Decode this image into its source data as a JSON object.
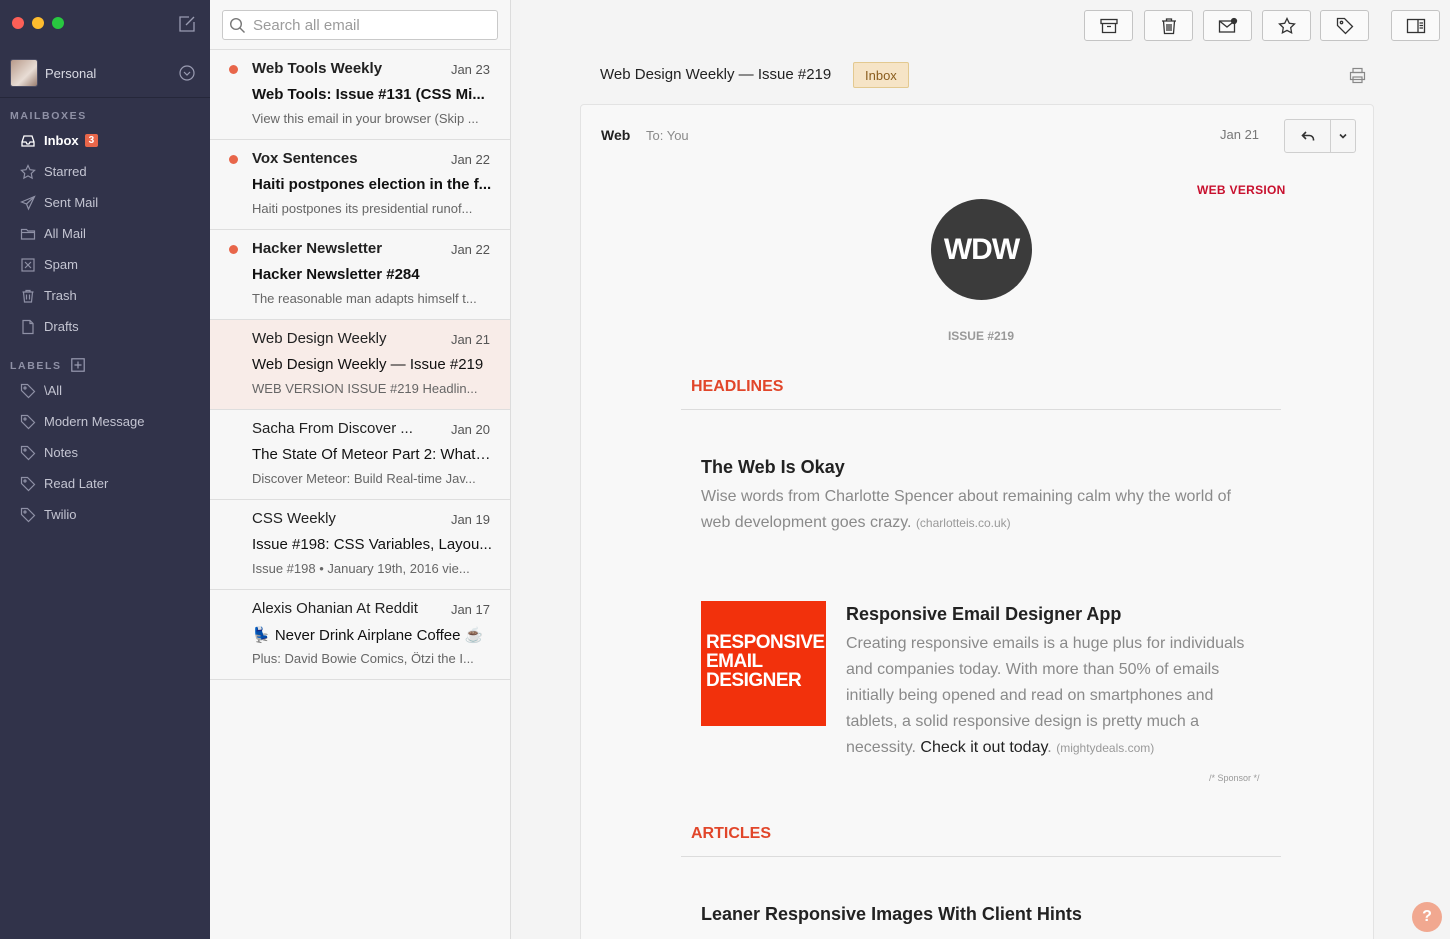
{
  "sidebar": {
    "account_name": "Personal",
    "mailboxes_title": "MAILBOXES",
    "labels_title": "LABELS",
    "mailboxes": [
      {
        "label": "Inbox",
        "icon": "inbox-icon",
        "badge": "3"
      },
      {
        "label": "Starred",
        "icon": "star-icon"
      },
      {
        "label": "Sent Mail",
        "icon": "send-icon"
      },
      {
        "label": "All Mail",
        "icon": "folder-icon"
      },
      {
        "label": "Spam",
        "icon": "spam-icon"
      },
      {
        "label": "Trash",
        "icon": "trash-icon"
      },
      {
        "label": "Drafts",
        "icon": "document-icon"
      }
    ],
    "labels": [
      {
        "label": "\\All"
      },
      {
        "label": "Modern Message"
      },
      {
        "label": "Notes"
      },
      {
        "label": "Read Later"
      },
      {
        "label": "Twilio"
      }
    ]
  },
  "search": {
    "placeholder": "Search all email"
  },
  "messages": [
    {
      "from": "Web Tools Weekly",
      "date": "Jan 23",
      "subject": "Web Tools: Issue #131 (CSS Mi...",
      "preview": "View this email in your browser (Skip ...",
      "unread": true
    },
    {
      "from": "Vox Sentences",
      "date": "Jan 22",
      "subject": "Haiti postpones election in the f...",
      "preview": "Haiti postpones its presidential runof...",
      "unread": true
    },
    {
      "from": "Hacker Newsletter",
      "date": "Jan 22",
      "subject": "Hacker Newsletter #284",
      "preview": "The reasonable man adapts himself t...",
      "unread": true
    },
    {
      "from": "Web Design Weekly",
      "date": "Jan 21",
      "subject": "Web Design Weekly — Issue #219",
      "preview": "WEB VERSION ISSUE #219 Headlin...",
      "unread": false,
      "selected": true
    },
    {
      "from": "Sacha From Discover ...",
      "date": "Jan 20",
      "subject": "The State Of Meteor Part 2: What ...",
      "preview": "Discover Meteor: Build Real-time Jav...",
      "unread": false
    },
    {
      "from": "CSS Weekly",
      "date": "Jan 19",
      "subject": "Issue #198: CSS Variables, Layou...",
      "preview": "Issue #198 • January 19th, 2016 vie...",
      "unread": false
    },
    {
      "from": "Alexis Ohanian At Reddit",
      "date": "Jan 17",
      "subject": "💺 Never Drink Airplane Coffee ☕",
      "preview": "Plus: David Bowie Comics, Ötzi the I...",
      "unread": false
    }
  ],
  "toolbar": {
    "buttons": [
      "archive-icon",
      "trash-icon",
      "mark-unread-icon",
      "star-icon",
      "tag-icon",
      "sidebar-toggle-icon"
    ]
  },
  "reader": {
    "title": "Web Design Weekly — Issue #219",
    "tag": "Inbox",
    "from": "Web",
    "to": "To: You",
    "date": "Jan 21"
  },
  "email": {
    "web_version": "WEB VERSION",
    "logo_text": "WDW",
    "issue": "ISSUE #219",
    "headlines_title": "HEADLINES",
    "article1_title": "The Web Is Okay",
    "article1_body": "Wise words from Charlotte Spencer about remaining calm why the world of web development goes crazy.",
    "article1_source": "(charlotteis.co.uk)",
    "promo_lines": [
      "RESPONSIVE",
      "EMAIL",
      "DESIGNER"
    ],
    "article2_title": "Responsive Email Designer App",
    "article2_body": "Creating responsive emails is a huge plus for individuals and companies today. With more than 50% of emails initially being opened and read on smartphones and tablets, a solid responsive design is pretty much a necessity.",
    "article2_link": "Check it out today",
    "article2_after_link": ".",
    "article2_source": "(mightydeals.com)",
    "sponsor_note": "/* Sponsor */",
    "articles_title": "ARTICLES",
    "article3_title": "Leaner Responsive Images With Client Hints"
  },
  "help_label": "?",
  "colors": {
    "sidebar": "#31334a",
    "accent": "#e8664a",
    "section_heading": "#e1462a",
    "web_version": "#c8102e"
  }
}
